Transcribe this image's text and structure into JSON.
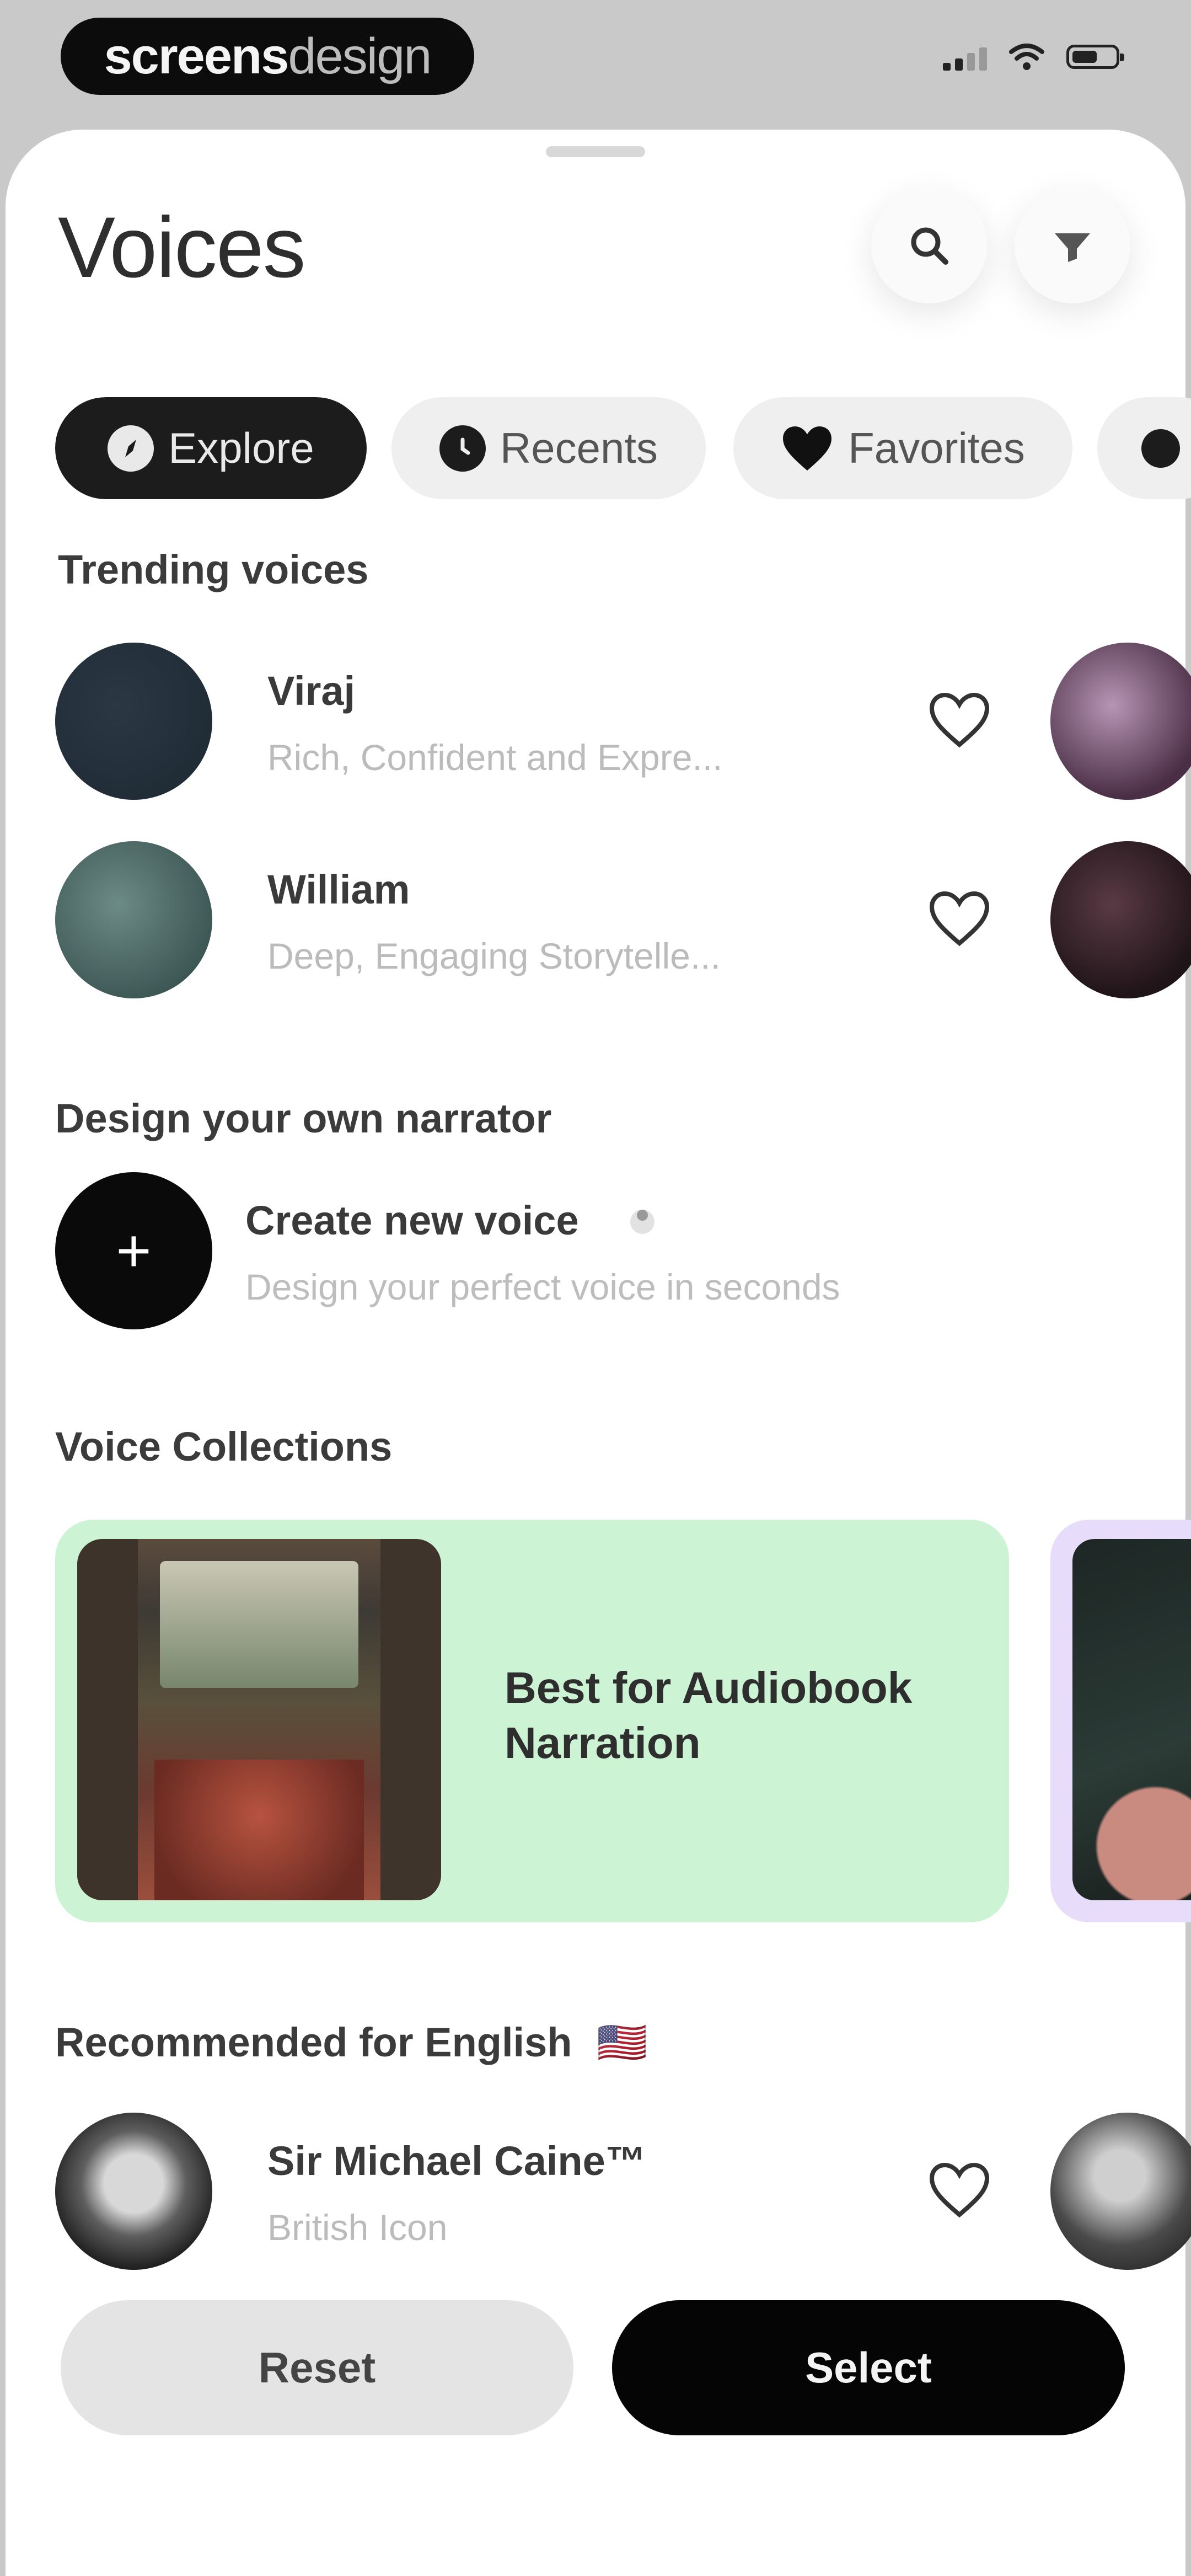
{
  "status_bar": {
    "brand_bold": "screens",
    "brand_light": "design"
  },
  "header": {
    "title": "Voices"
  },
  "tabs": [
    {
      "label": "Explore",
      "active": true
    },
    {
      "label": "Recents",
      "active": false
    },
    {
      "label": "Favorites",
      "active": false
    }
  ],
  "trending": {
    "heading": "Trending voices",
    "items": [
      {
        "name": "Viraj",
        "description": "Rich, Confident and Expre...",
        "avatar_color": "#1f2a33"
      },
      {
        "name": "William",
        "description": "Deep, Engaging Storytelle...",
        "avatar_color": "#4e6a68"
      }
    ]
  },
  "design_section": {
    "heading": "Design your own narrator",
    "create_title": "Create new voice",
    "create_subtitle": "Design your perfect voice in seconds"
  },
  "collections": {
    "heading": "Voice Collections",
    "cards": [
      {
        "title": "Best for Audiobook Narration",
        "color": "#cdf3d5"
      }
    ]
  },
  "recommended": {
    "heading": "Recommended for English",
    "flag": "🇺🇸",
    "items": [
      {
        "name": "Sir Michael Caine™",
        "description": "British Icon"
      }
    ]
  },
  "actions": {
    "reset_label": "Reset",
    "select_label": "Select"
  },
  "colors": {
    "accent_dark": "#050505",
    "collection_green": "#cdf3d5",
    "collection_purple": "#e8dcfb"
  }
}
